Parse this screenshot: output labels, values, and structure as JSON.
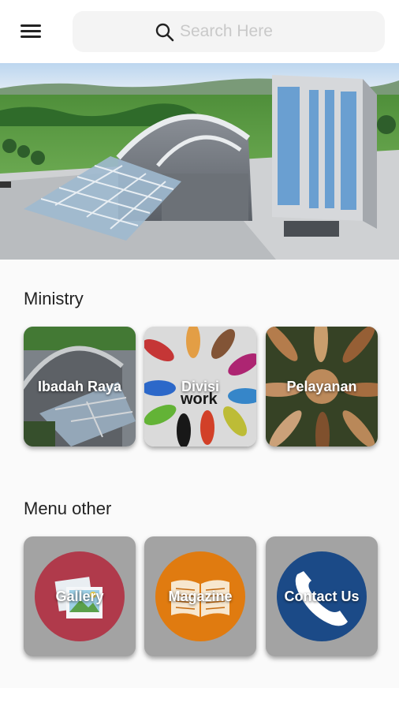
{
  "header": {
    "menu_icon": "hamburger-menu-icon",
    "search": {
      "placeholder": "Search Here",
      "icon": "search-icon"
    }
  },
  "ministry": {
    "title": "Ministry",
    "items": [
      {
        "label": "Ibadah Raya"
      },
      {
        "label": "Divisi"
      },
      {
        "label": "Pelayanan"
      }
    ]
  },
  "menu_other": {
    "title": "Menu other",
    "items": [
      {
        "label": "Gallery",
        "icon": "gallery-photos-icon",
        "color": "#b03a4b"
      },
      {
        "label": "Magazine",
        "icon": "open-book-icon",
        "color": "#e07b10"
      },
      {
        "label": "Contact Us",
        "icon": "phone-icon",
        "color": "#1b4a87"
      }
    ]
  }
}
